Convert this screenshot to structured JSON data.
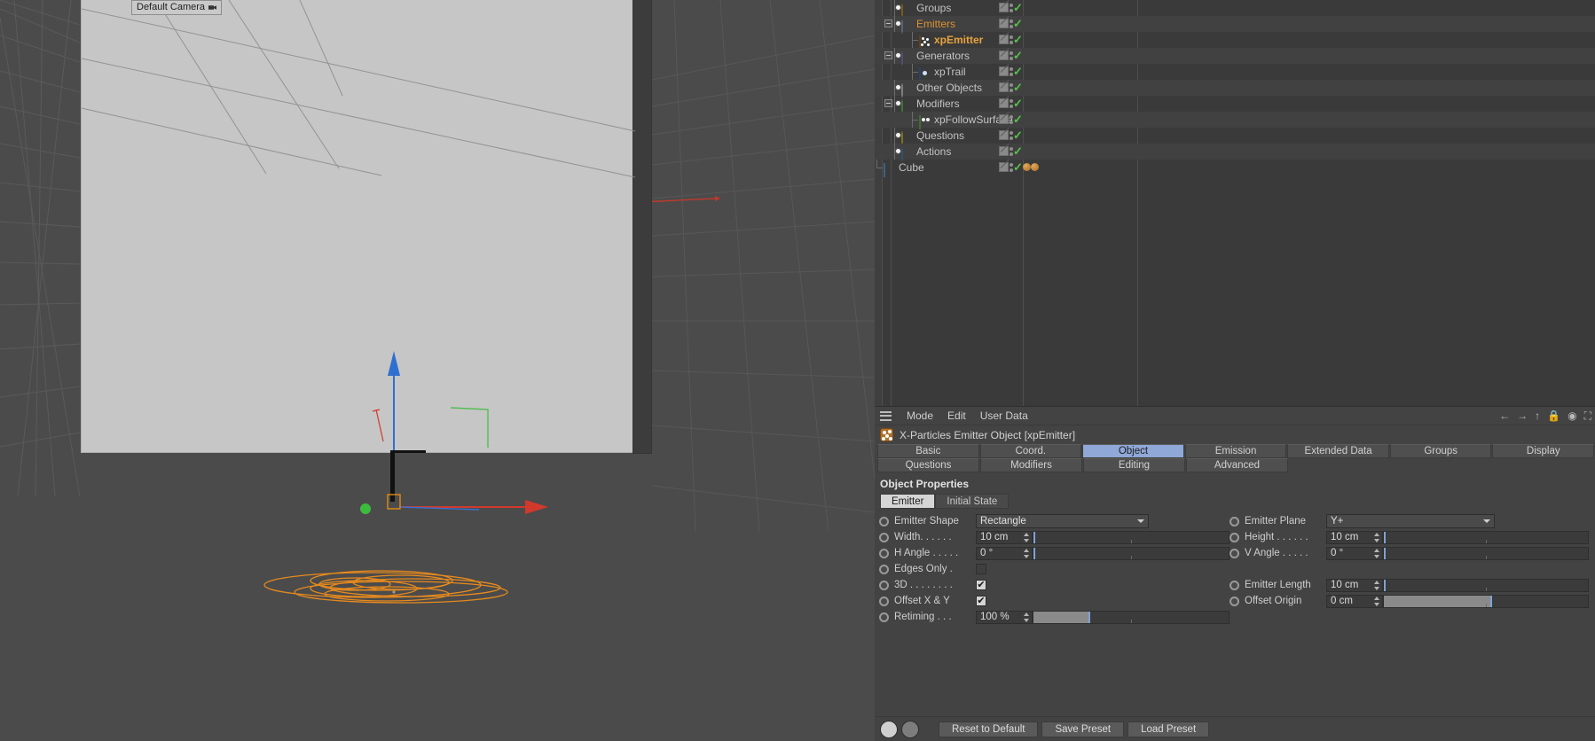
{
  "viewport": {
    "camera_label": "Default Camera",
    "camera_icon": "camera-icon"
  },
  "object_manager": {
    "rows": [
      {
        "label": "Groups",
        "icon": "pie-orange-icon",
        "depth": 1,
        "expander": false,
        "style": "normal",
        "tags": [
          "visibility-toggle",
          "dots",
          "green-check"
        ]
      },
      {
        "label": "Emitters",
        "icon": "pie-lblue-icon",
        "depth": 1,
        "expander": true,
        "style": "orange",
        "tags": [
          "visibility-toggle",
          "dots",
          "green-check"
        ]
      },
      {
        "label": "xpEmitter",
        "icon": "xp-emitter-icon",
        "depth": 2,
        "expander": false,
        "style": "orangebold",
        "tags": [
          "visibility-toggle",
          "dots",
          "green-check"
        ]
      },
      {
        "label": "Generators",
        "icon": "pie-purple-icon",
        "depth": 1,
        "expander": true,
        "style": "normal",
        "tags": [
          "visibility-toggle",
          "dots",
          "green-check"
        ]
      },
      {
        "label": "xpTrail",
        "icon": "xp-trail-icon",
        "depth": 2,
        "expander": false,
        "style": "normal",
        "tags": [
          "visibility-toggle",
          "dots",
          "green-check"
        ]
      },
      {
        "label": "Other Objects",
        "icon": "pie-white-icon",
        "depth": 1,
        "expander": false,
        "style": "normal",
        "tags": [
          "visibility-toggle",
          "dots",
          "green-check"
        ]
      },
      {
        "label": "Modifiers",
        "icon": "pie-green-icon",
        "depth": 1,
        "expander": true,
        "style": "normal",
        "tags": [
          "visibility-toggle",
          "dots",
          "green-check"
        ]
      },
      {
        "label": "xpFollowSurface",
        "icon": "xp-follow-icon",
        "depth": 2,
        "expander": false,
        "style": "normal",
        "tags": [
          "visibility-toggle",
          "dots",
          "green-check"
        ]
      },
      {
        "label": "Questions",
        "icon": "pie-yellow-icon",
        "depth": 1,
        "expander": false,
        "style": "normal",
        "tags": [
          "visibility-toggle",
          "dots",
          "green-check"
        ]
      },
      {
        "label": "Actions",
        "icon": "pie-blue-icon",
        "depth": 1,
        "expander": false,
        "style": "normal",
        "tags": [
          "visibility-toggle",
          "dots",
          "green-check"
        ]
      },
      {
        "label": "Cube",
        "icon": "cube-icon",
        "depth": 0,
        "expander": false,
        "style": "normal",
        "tags": [
          "visibility-toggle",
          "dots",
          "green-check",
          "tag-ball",
          "tag-ball"
        ]
      }
    ]
  },
  "attribute_manager": {
    "menu": [
      "Mode",
      "Edit",
      "User Data"
    ],
    "hamburger_icon": "hamburger-icon",
    "header_icons": [
      "arrow-left-icon",
      "arrow-right-icon",
      "arrow-up-icon",
      "lock-icon",
      "target-icon",
      "expand-icon"
    ],
    "title": "X-Particles Emitter Object [xpEmitter]",
    "title_icon": "xp-emitter-icon",
    "tabs_row1": [
      "Basic",
      "Coord.",
      "Object",
      "Emission",
      "Extended Data",
      "Groups",
      "Display"
    ],
    "tabs_row2": [
      "Questions",
      "Modifiers",
      "Editing",
      "Advanced"
    ],
    "active_tab": "Object",
    "section_title": "Object Properties",
    "subtabs": [
      "Emitter",
      "Initial State"
    ],
    "active_subtab": "Emitter",
    "properties": [
      {
        "left": {
          "label": "Emitter Shape",
          "type": "dropdown",
          "value": "Rectangle"
        },
        "right": {
          "label": "Emitter Plane",
          "type": "dropdown",
          "value": "Y+"
        }
      },
      {
        "left": {
          "label": "Width. . . . . .",
          "type": "number-slider",
          "value": "10 cm",
          "fill": 0
        },
        "right": {
          "label": "Height . . . . . .",
          "type": "number-slider",
          "value": "10 cm",
          "fill": 0
        }
      },
      {
        "left": {
          "label": "H Angle . . . . .",
          "type": "number-slider",
          "value": "0 °",
          "fill": 0
        },
        "right": {
          "label": "V Angle . . . . .",
          "type": "number-slider",
          "value": "0 °",
          "fill": 0
        }
      },
      {
        "left": {
          "label": "Edges Only  .",
          "type": "checkbox",
          "value": false
        },
        "right": null
      },
      {
        "left": {
          "label": "3D . . . . . . . .",
          "type": "checkbox",
          "value": true
        },
        "right": {
          "label": "Emitter Length",
          "type": "number-slider",
          "value": "10 cm",
          "fill": 0
        }
      },
      {
        "left": {
          "label": "Offset X & Y",
          "type": "checkbox",
          "value": true
        },
        "right": {
          "label": "Offset Origin",
          "type": "number-slider",
          "value": "0 cm",
          "fill": 52
        }
      },
      {
        "left": {
          "label": "Retiming  . . .",
          "type": "number-slider",
          "value": "100 %",
          "fill": 28
        },
        "right": null
      }
    ],
    "buttons": [
      "Reset to Default",
      "Save Preset",
      "Load Preset"
    ]
  },
  "colors": {
    "accent_tab": "#8fa8d8",
    "orange_text": "#dd9133",
    "check_green": "#56c24a",
    "panel_bg": "#434343",
    "viewport_bg": "#4b4b4b"
  }
}
